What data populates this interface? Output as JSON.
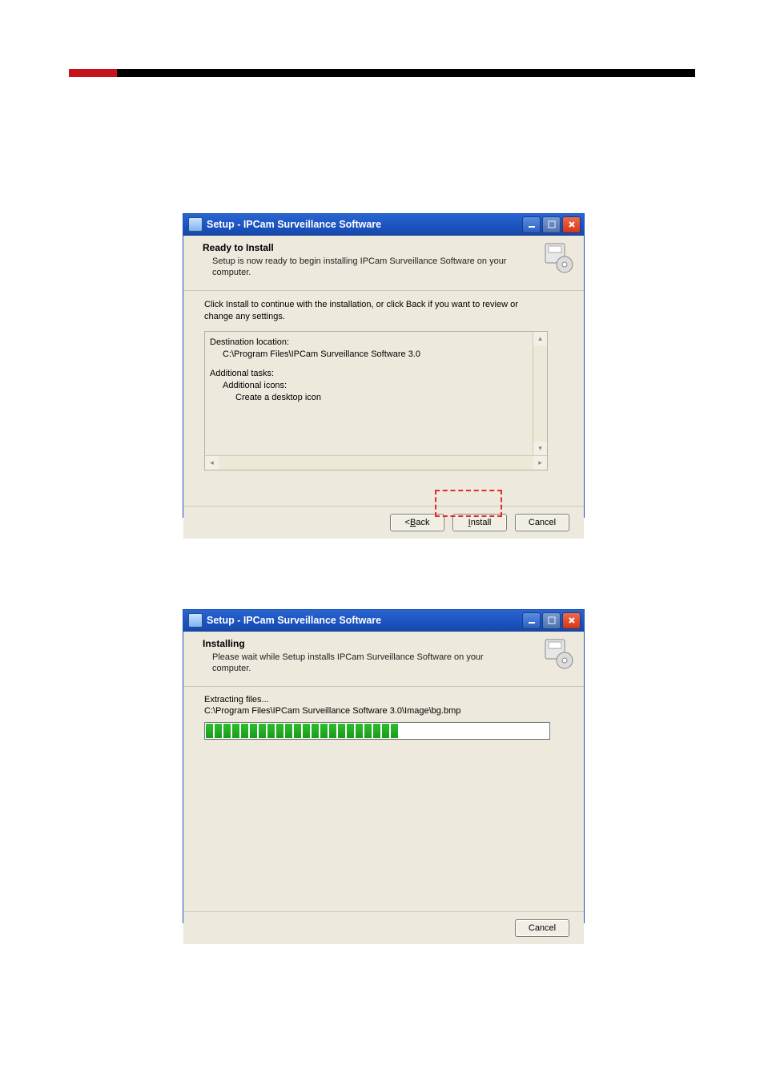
{
  "dialog1": {
    "title": "Setup - IPCam Surveillance Software",
    "header_title": "Ready to Install",
    "header_sub": "Setup is now ready to begin installing IPCam Surveillance Software on your computer.",
    "instruction": "Click Install to continue with the installation, or click Back if you want to review or change any settings.",
    "summary": {
      "dest_label": "Destination location:",
      "dest_value": "C:\\Program Files\\IPCam Surveillance Software 3.0",
      "tasks_label": "Additional tasks:",
      "icons_label": "Additional icons:",
      "desktop_icon": "Create a desktop icon"
    },
    "buttons": {
      "back": "< Back",
      "install": "Install",
      "cancel": "Cancel"
    }
  },
  "dialog2": {
    "title": "Setup - IPCam Surveillance Software",
    "header_title": "Installing",
    "header_sub": "Please wait while Setup installs IPCam Surveillance Software on your computer.",
    "extracting_label": "Extracting files...",
    "extracting_path": "C:\\Program Files\\IPCam Surveillance Software 3.0\\Image\\bg.bmp",
    "progress_percent": 59,
    "buttons": {
      "cancel": "Cancel"
    }
  }
}
